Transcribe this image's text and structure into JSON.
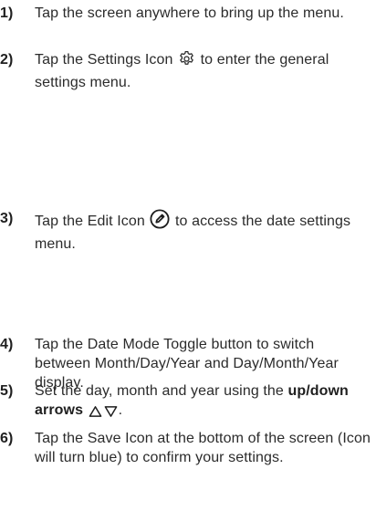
{
  "steps": [
    {
      "number": "1)",
      "text": "Tap the screen anywhere to bring up the menu."
    },
    {
      "number": "2)",
      "text_before": "Tap the Settings Icon",
      "icon": "gear-icon",
      "text_after": "to enter the general settings menu."
    },
    {
      "number": "3)",
      "text_before": "Tap the Edit Icon",
      "icon": "pencil-circle-icon",
      "text_after": "to access the date settings menu."
    },
    {
      "number": "4)",
      "text": "Tap the Date Mode Toggle button to switch between Month/Day/Year and Day/Month/Year display."
    },
    {
      "number": "5)",
      "text_before": "Set the day, month and year using the",
      "bold_text": "up/down arrows",
      "icons": [
        "up-triangle-icon",
        "down-triangle-icon"
      ],
      "text_after": "."
    },
    {
      "number": "6)",
      "text": "Tap the Save Icon at the bottom of the screen (Icon will turn blue) to confirm your settings."
    }
  ]
}
